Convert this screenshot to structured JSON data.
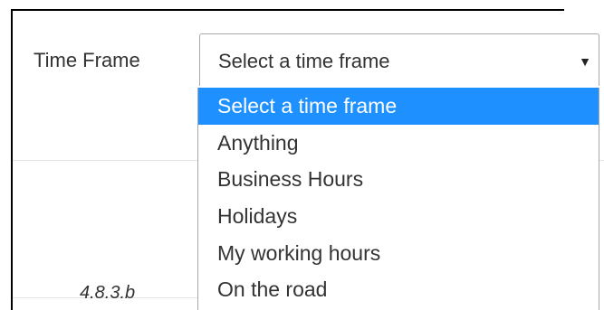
{
  "form": {
    "time_frame_label": "Time Frame",
    "select": {
      "value": "Select a time frame",
      "arrow_icon": "caret-down-icon"
    },
    "options": [
      "Select a time frame",
      "Anything",
      "Business Hours",
      "Holidays",
      "My working hours",
      "On the road"
    ],
    "selected_index": 0
  },
  "footer": {
    "version": "4.8.3.b"
  },
  "colors": {
    "highlight": "#1E90FF",
    "text": "#333333",
    "border": "#A9A9A9"
  }
}
